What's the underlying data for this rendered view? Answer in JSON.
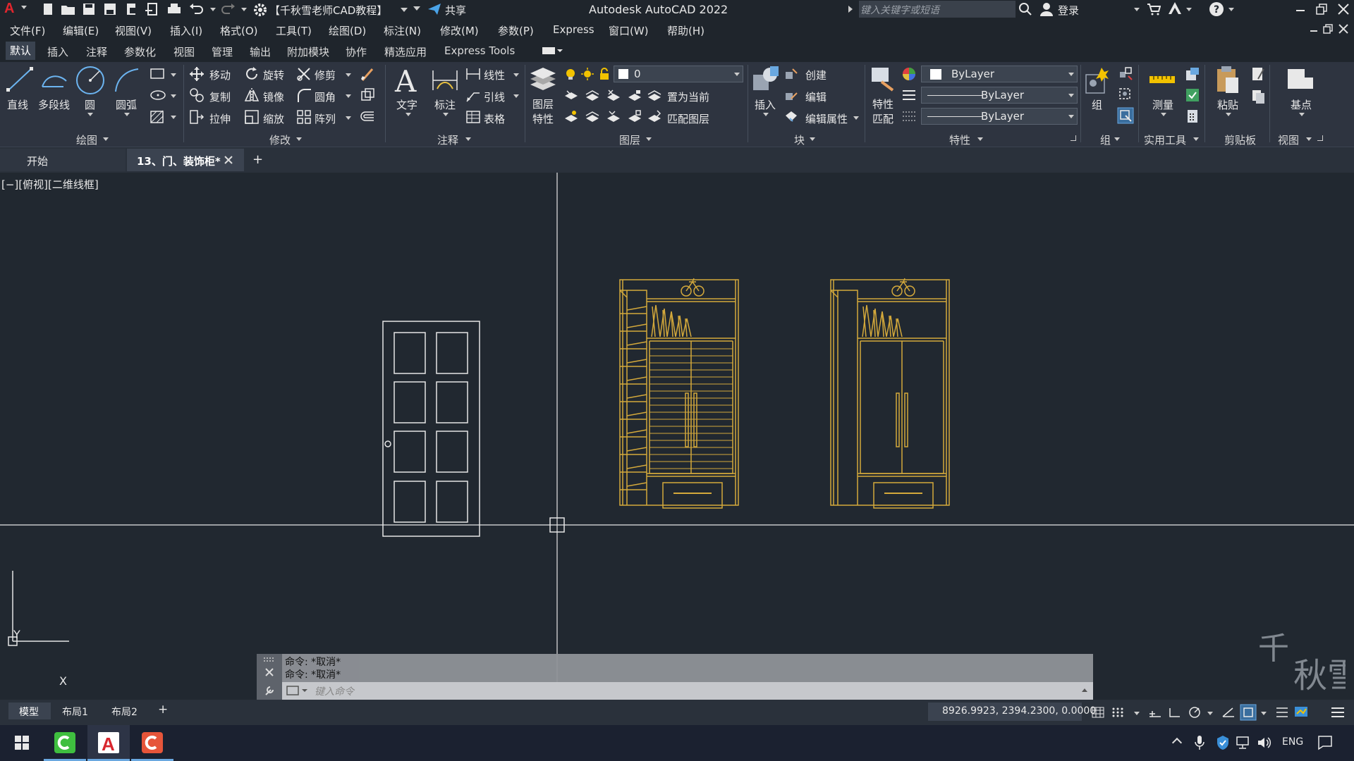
{
  "titlebar": {
    "app_letter": "A",
    "workspace": "【千秋雪老师CAD教程】",
    "share": "共享",
    "title": "Autodesk AutoCAD 2022",
    "search_placeholder": "键入关键字或短语",
    "login": "登录"
  },
  "menu": [
    "文件(F)",
    "编辑(E)",
    "视图(V)",
    "插入(I)",
    "格式(O)",
    "工具(T)",
    "绘图(D)",
    "标注(N)",
    "修改(M)",
    "参数(P)",
    "Express",
    "窗口(W)",
    "帮助(H)"
  ],
  "ribbon_tabs": [
    "默认",
    "插入",
    "注释",
    "参数化",
    "视图",
    "管理",
    "输出",
    "附加模块",
    "协作",
    "精选应用",
    "Express Tools"
  ],
  "ribbon": {
    "draw": {
      "line": "直线",
      "polyline": "多段线",
      "circle": "圆",
      "arc": "圆弧",
      "group": "绘图"
    },
    "modify": {
      "move": "移动",
      "rotate": "旋转",
      "trim": "修剪",
      "copy": "复制",
      "mirror": "镜像",
      "fillet": "圆角",
      "stretch": "拉伸",
      "scale": "缩放",
      "array": "阵列",
      "group": "修改"
    },
    "annotation": {
      "text": "文字",
      "dim": "标注",
      "linear": "线性",
      "leader": "引线",
      "table": "表格",
      "group": "注释"
    },
    "layers": {
      "props": "图层\n特性",
      "layer_value": "0",
      "set_current": "置为当前",
      "match": "匹配图层",
      "group": "图层"
    },
    "block": {
      "insert": "插入",
      "create": "创建",
      "edit": "编辑",
      "edit_attr": "编辑属性",
      "group": "块"
    },
    "properties": {
      "match": "特性\n匹配",
      "color": "ByLayer",
      "linetype": "ByLayer",
      "lineweight": "ByLayer",
      "group": "特性"
    },
    "groups": {
      "group_btn": "组",
      "group": "组"
    },
    "utilities": {
      "measure": "测量",
      "group": "实用工具"
    },
    "clipboard": {
      "paste": "粘贴",
      "group": "剪贴板"
    },
    "view": {
      "base": "基点",
      "group": "视图"
    }
  },
  "doc_tabs": {
    "start": "开始",
    "active": "13、门、装饰柜*",
    "new_tab": "+"
  },
  "viewport_label": "[−][俯视][二维线框]",
  "command": {
    "history": [
      "命令: *取消*",
      "命令: *取消*"
    ],
    "placeholder": "键入命令"
  },
  "layout_tabs": [
    "模型",
    "布局1",
    "布局2",
    "+"
  ],
  "status": {
    "coords": "8926.9923, 2394.2300, 0.0000",
    "lang": "ENG"
  },
  "ucs": {
    "x": "X",
    "y": "Y"
  },
  "colors": {
    "drawing": "#d4a93b",
    "door": "#e6e6e6",
    "bg": "#212830",
    "accent": "#3a8fd8"
  }
}
